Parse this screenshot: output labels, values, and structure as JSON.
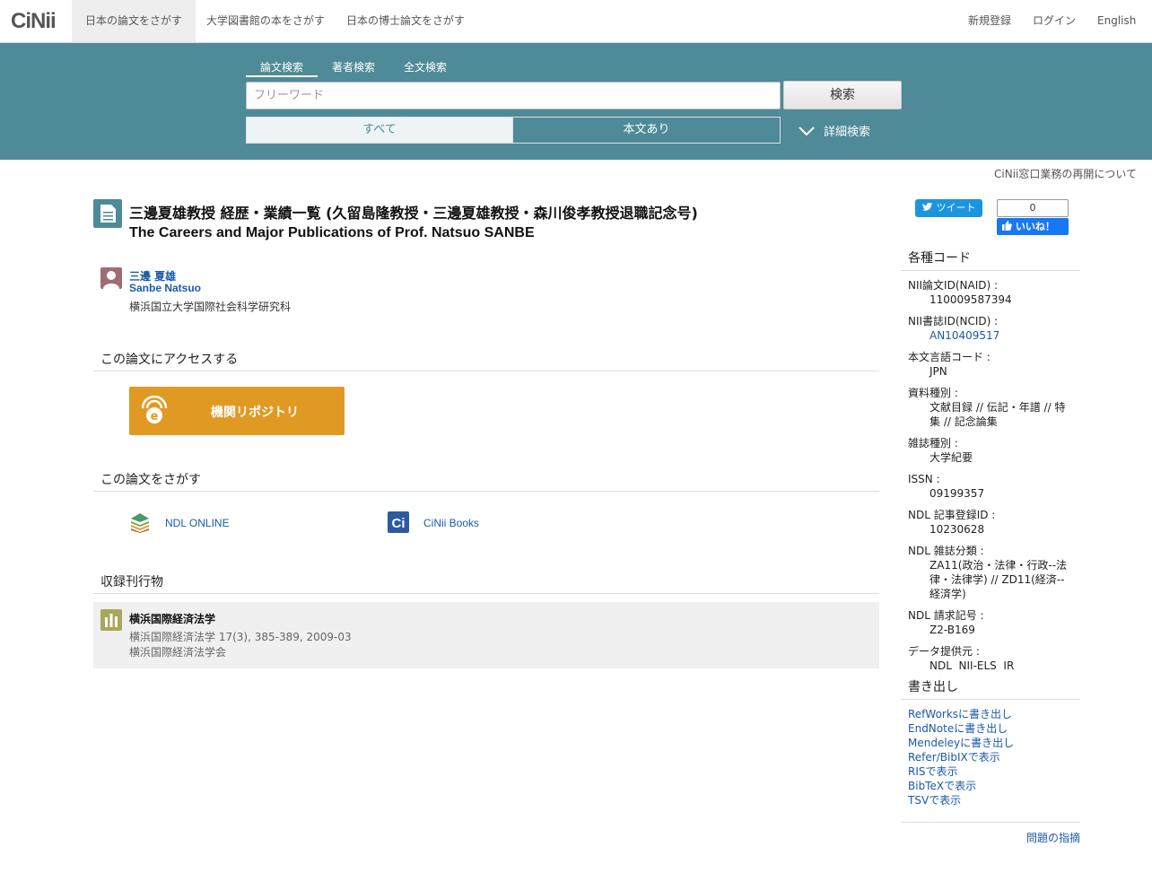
{
  "header": {
    "logo": "CiNii",
    "tabs": [
      "日本の論文をさがす",
      "大学図書館の本をさがす",
      "日本の博士論文をさがす"
    ],
    "right": [
      "新規登録",
      "ログイン",
      "English"
    ]
  },
  "search": {
    "tabs": [
      "論文検索",
      "著者検索",
      "全文検索"
    ],
    "placeholder": "フリーワード",
    "button": "検索",
    "filters": [
      "すべて",
      "本文あり"
    ],
    "advanced": "詳細検索"
  },
  "notice": "CiNii窓口業務の再開について",
  "article": {
    "title_ja": "三邊夏雄教授 経歴・業績一覧 (久留島隆教授・三邊夏雄教授・森川俊孝教授退職記念号)",
    "title_en": "The Careers and Major Publications of Prof. Natsuo SANBE",
    "author_ja": "三邊 夏雄",
    "author_en": "Sanbe Natsuo",
    "affiliation": "横浜国立大学国際社会科学研究科"
  },
  "access": {
    "heading": "この論文にアクセスする",
    "repository_label": "機関リポジトリ"
  },
  "find": {
    "heading": "この論文をさがす",
    "links": [
      "NDL ONLINE",
      "CiNii Books"
    ]
  },
  "journal": {
    "heading": "収録刊行物",
    "name": "横浜国際経済法学",
    "volume": "横浜国際経済法学 17(3), 385-389, 2009-03",
    "publisher": "横浜国際経済法学会"
  },
  "social": {
    "tweet": "ツイート",
    "like_count": "0",
    "like": "いいね！"
  },
  "codes": {
    "heading": "各種コード",
    "items": [
      {
        "label": "NII論文ID(NAID) :",
        "value": "110009587394"
      },
      {
        "label": "NII書誌ID(NCID) :",
        "value": "AN10409517"
      },
      {
        "label": "本文言語コード :",
        "value": "JPN"
      },
      {
        "label": "資料種別 :",
        "value": "文献目録 // 伝記・年譜 // 特集 // 記念論集"
      },
      {
        "label": "雑誌種別 :",
        "value": "大学紀要"
      },
      {
        "label": "ISSN :",
        "value": "09199357"
      },
      {
        "label": "NDL 記事登録ID :",
        "value": "10230628"
      },
      {
        "label": "NDL 雑誌分類 :",
        "value": "ZA11(政治・法律・行政--法律・法律学) // ZD11(経済--経済学)"
      },
      {
        "label": "NDL 請求記号 :",
        "value": "Z2-B169"
      },
      {
        "label": "データ提供元 :",
        "value": "NDL  NII-ELS  IR"
      }
    ]
  },
  "export": {
    "heading": "書き出し",
    "items": [
      "RefWorksに書き出し",
      "EndNoteに書き出し",
      "Mendeleyに書き出し",
      "Refer/BibIXで表示",
      "RISで表示",
      "BibTeXで表示",
      "TSVで表示"
    ]
  },
  "footer": {
    "report": "問題の指摘"
  },
  "colors": {
    "band": "#4e8a97",
    "repository": "#e09a23",
    "link": "#1a5aa8"
  }
}
